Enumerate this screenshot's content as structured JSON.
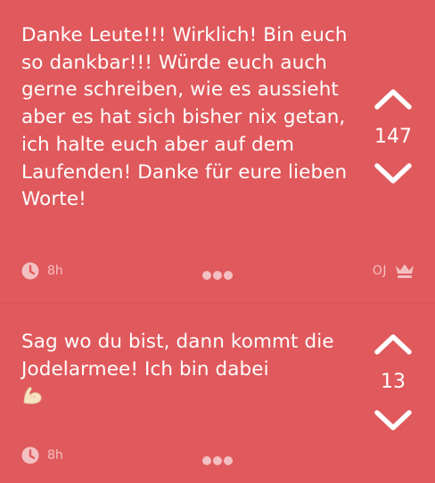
{
  "posts": [
    {
      "message": "Danke Leute!!! Wirklich! Bin euch so dankbar!!! Würde euch auch gerne schreiben, wie es aussieht aber es hat sich bisher nix getan, ich halte euch aber auf dem Laufenden! Danke für eure lieben Worte!",
      "score": "147",
      "time": "8h",
      "author_tag": "OJ",
      "icons": {
        "upvote": "chevron-up-icon",
        "downvote": "chevron-down-icon",
        "time": "clock-icon",
        "more": "more-dots-icon",
        "author": "crown-icon"
      }
    },
    {
      "message": "Sag wo du bist, dann kommt die Jodelarmee! Ich bin dabei",
      "emoji": "💪",
      "score": "13",
      "time": "8h",
      "icons": {
        "upvote": "chevron-up-icon",
        "downvote": "chevron-down-icon",
        "time": "clock-icon",
        "more": "more-dots-icon",
        "emoji": "flexed-biceps-icon"
      }
    }
  ],
  "colors": {
    "background": "#e0595c",
    "text": "#ffffff",
    "muted": "#f3b4b5"
  }
}
